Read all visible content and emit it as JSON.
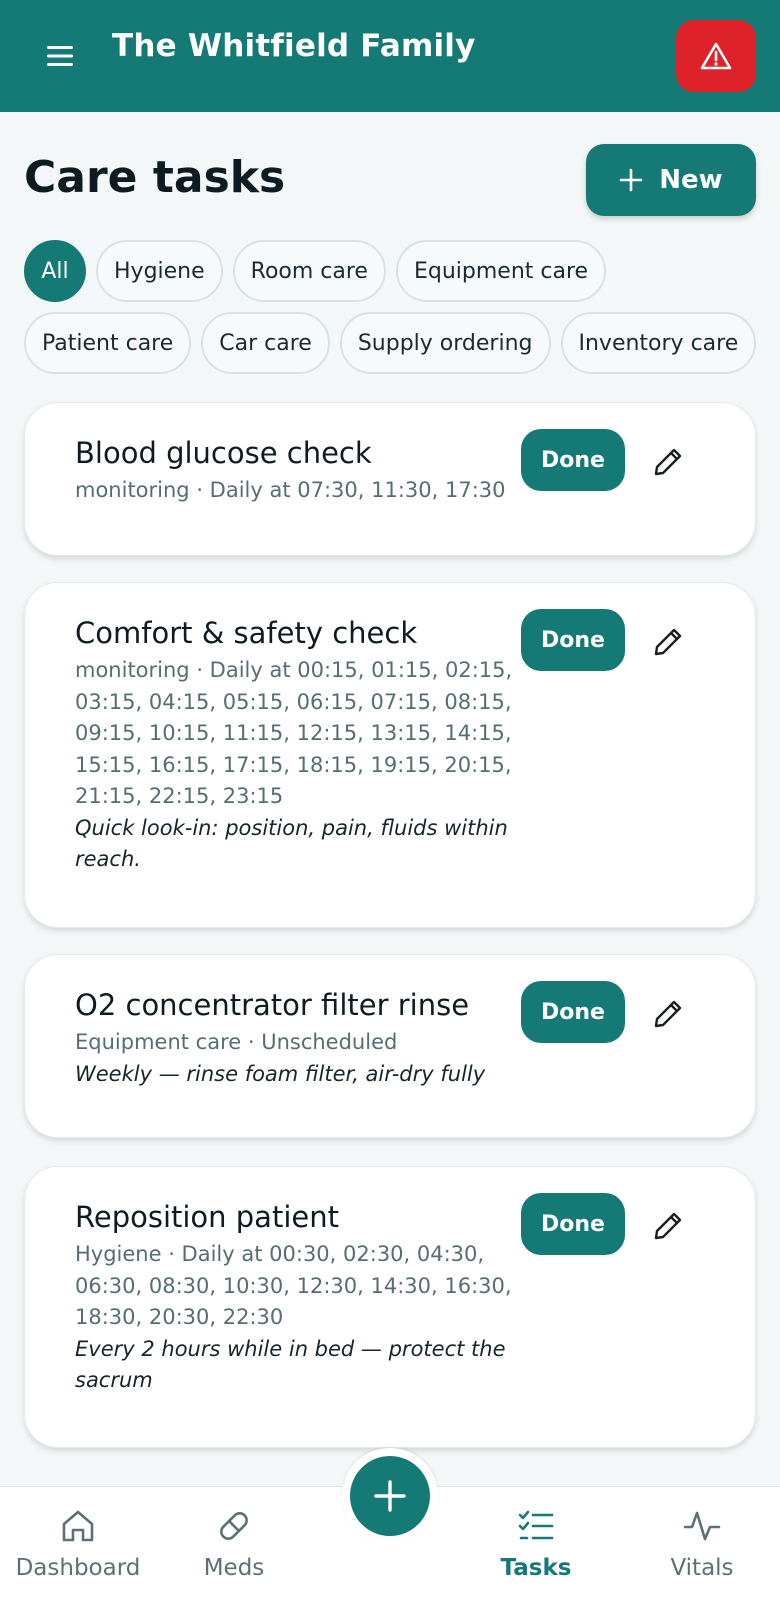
{
  "header": {
    "family_name": "The Whitfield Family",
    "menu_icon": "hamburger-menu-icon",
    "alert_icon": "warning-triangle-icon",
    "alert_color": "#dd2229",
    "brand_color": "#157a75"
  },
  "page": {
    "title": "Care tasks",
    "new_button_label": "New"
  },
  "filters": [
    {
      "label": "All",
      "active": true
    },
    {
      "label": "Hygiene",
      "active": false
    },
    {
      "label": "Room care",
      "active": false
    },
    {
      "label": "Equipment care",
      "active": false
    },
    {
      "label": "Patient care",
      "active": false
    },
    {
      "label": "Car care",
      "active": false
    },
    {
      "label": "Supply ordering",
      "active": false
    },
    {
      "label": "Inventory care",
      "active": false
    }
  ],
  "tasks": [
    {
      "title": "Blood glucose check",
      "meta": "monitoring · Daily at 07:30, 11:30, 17:30",
      "note": "",
      "done_label": "Done"
    },
    {
      "title": "Comfort & safety check",
      "meta": "monitoring · Daily at 00:15, 01:15, 02:15, 03:15, 04:15, 05:15, 06:15, 07:15, 08:15, 09:15, 10:15, 11:15, 12:15, 13:15, 14:15, 15:15, 16:15, 17:15, 18:15, 19:15, 20:15, 21:15, 22:15, 23:15",
      "note": "Quick look-in: position, pain, fluids within reach.",
      "done_label": "Done"
    },
    {
      "title": "O2 concentrator filter rinse",
      "meta": "Equipment care · Unscheduled",
      "note": "Weekly — rinse foam filter, air-dry fully",
      "done_label": "Done"
    },
    {
      "title": "Reposition patient",
      "meta": "Hygiene · Daily at 00:30, 02:30, 04:30, 06:30, 08:30, 10:30, 12:30, 14:30, 16:30, 18:30, 20:30, 22:30",
      "note": "Every 2 hours while in bed — protect the sacrum",
      "done_label": "Done"
    }
  ],
  "bottom_nav": {
    "items": [
      {
        "label": "Dashboard",
        "icon": "home-icon",
        "active": false
      },
      {
        "label": "Meds",
        "icon": "pill-icon",
        "active": false
      },
      {
        "label": "Tasks",
        "icon": "checklist-icon",
        "active": true
      },
      {
        "label": "Vitals",
        "icon": "pulse-icon",
        "active": false
      }
    ],
    "fab_icon": "plus-icon"
  }
}
